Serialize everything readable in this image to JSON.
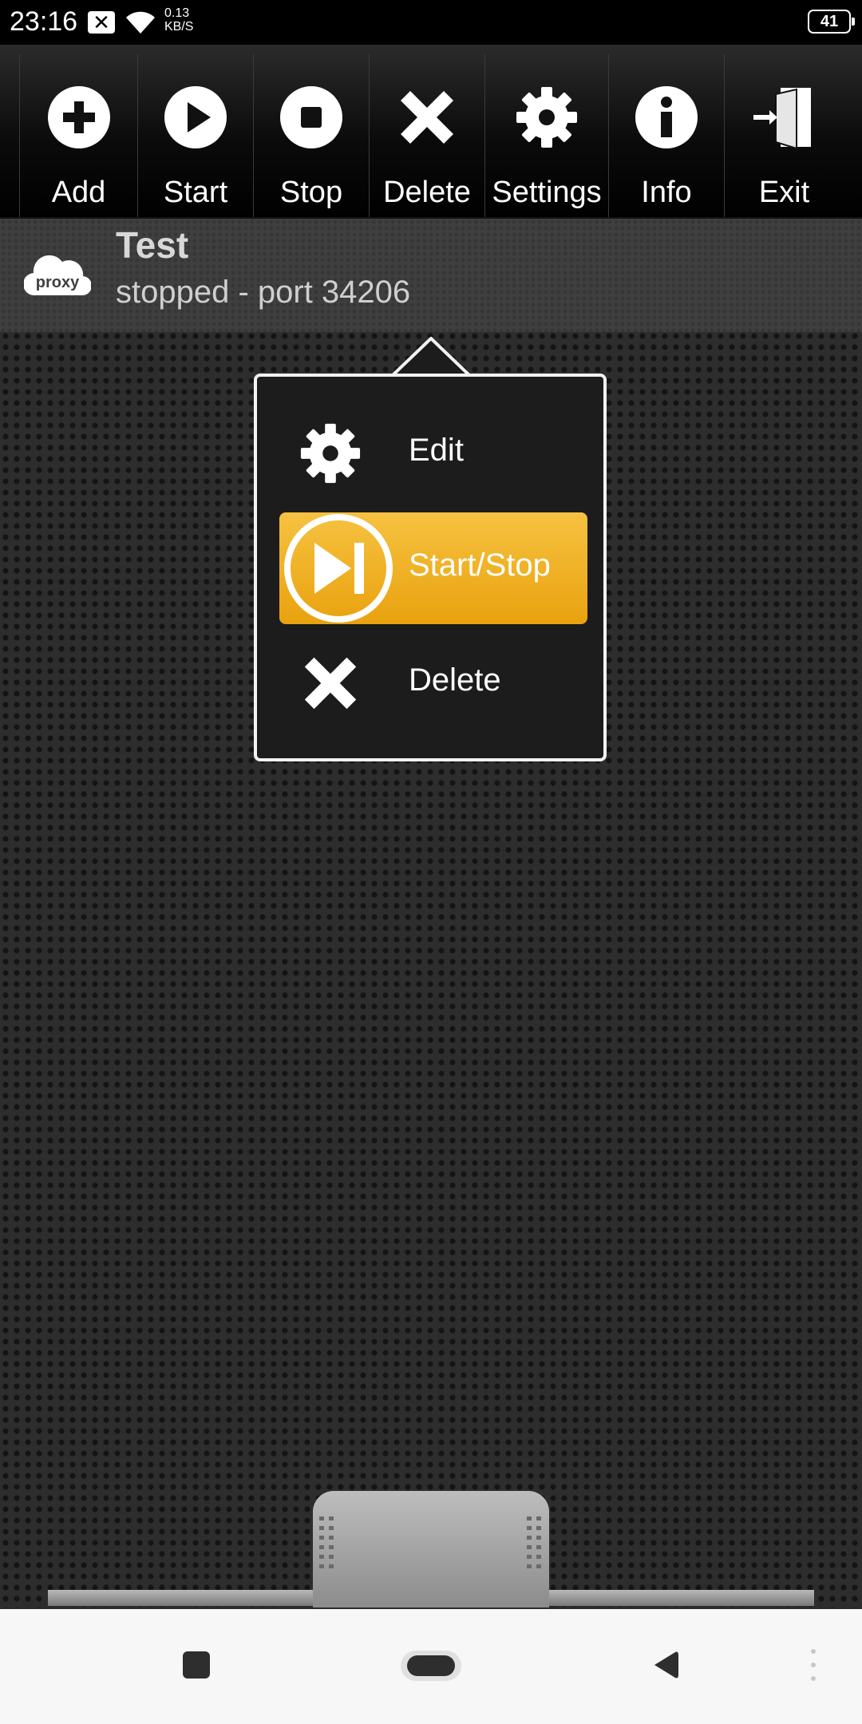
{
  "status_bar": {
    "time": "23:16",
    "speed_value": "0.13",
    "speed_unit": "KB/S",
    "battery": "41"
  },
  "toolbar": {
    "buttons": [
      {
        "label": "Add",
        "icon": "add-icon"
      },
      {
        "label": "Start",
        "icon": "play-icon"
      },
      {
        "label": "Stop",
        "icon": "stop-icon"
      },
      {
        "label": "Delete",
        "icon": "delete-icon"
      },
      {
        "label": "Settings",
        "icon": "gear-icon"
      },
      {
        "label": "Info",
        "icon": "info-icon"
      },
      {
        "label": "Exit",
        "icon": "exit-door-icon"
      }
    ]
  },
  "list": {
    "items": [
      {
        "title": "Test",
        "subtitle": "stopped - port 34206",
        "icon": "proxy-cloud-icon",
        "icon_text": "proxy"
      }
    ]
  },
  "context_menu": {
    "items": [
      {
        "label": "Edit",
        "icon": "gear-icon"
      },
      {
        "label": "Start/Stop",
        "icon": "play-pause-icon",
        "selected": true
      },
      {
        "label": "Delete",
        "icon": "delete-icon"
      }
    ]
  },
  "colors": {
    "accent": "#f0b020",
    "toolbar_bg": "#000000",
    "background": "#2d2d2d"
  }
}
